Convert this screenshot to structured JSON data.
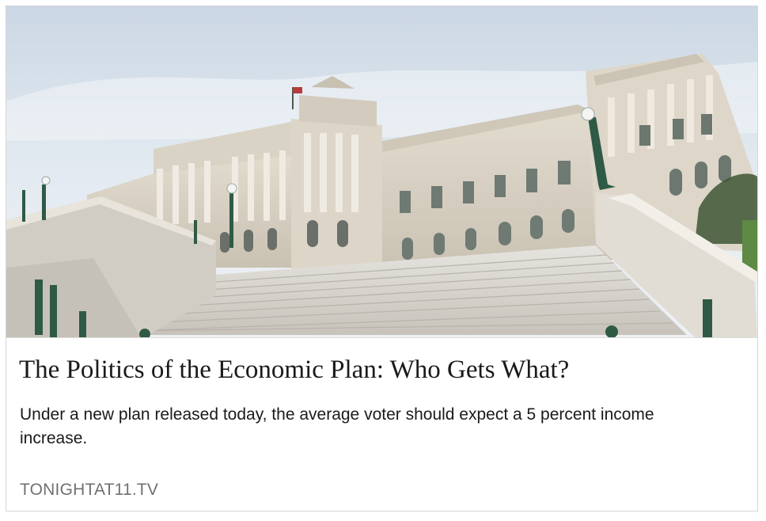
{
  "card": {
    "image": {
      "subject": "library-of-congress-building-steps",
      "sky_color": "#dde7f1",
      "stone_color": "#d5cec1",
      "accent_color": "#2f5a45"
    },
    "headline": "The Politics of the Economic Plan: Who Gets What?",
    "description": "Under a new plan released today, the average voter should expect a 5 percent income increase.",
    "domain": "TONIGHTAT11.TV"
  }
}
